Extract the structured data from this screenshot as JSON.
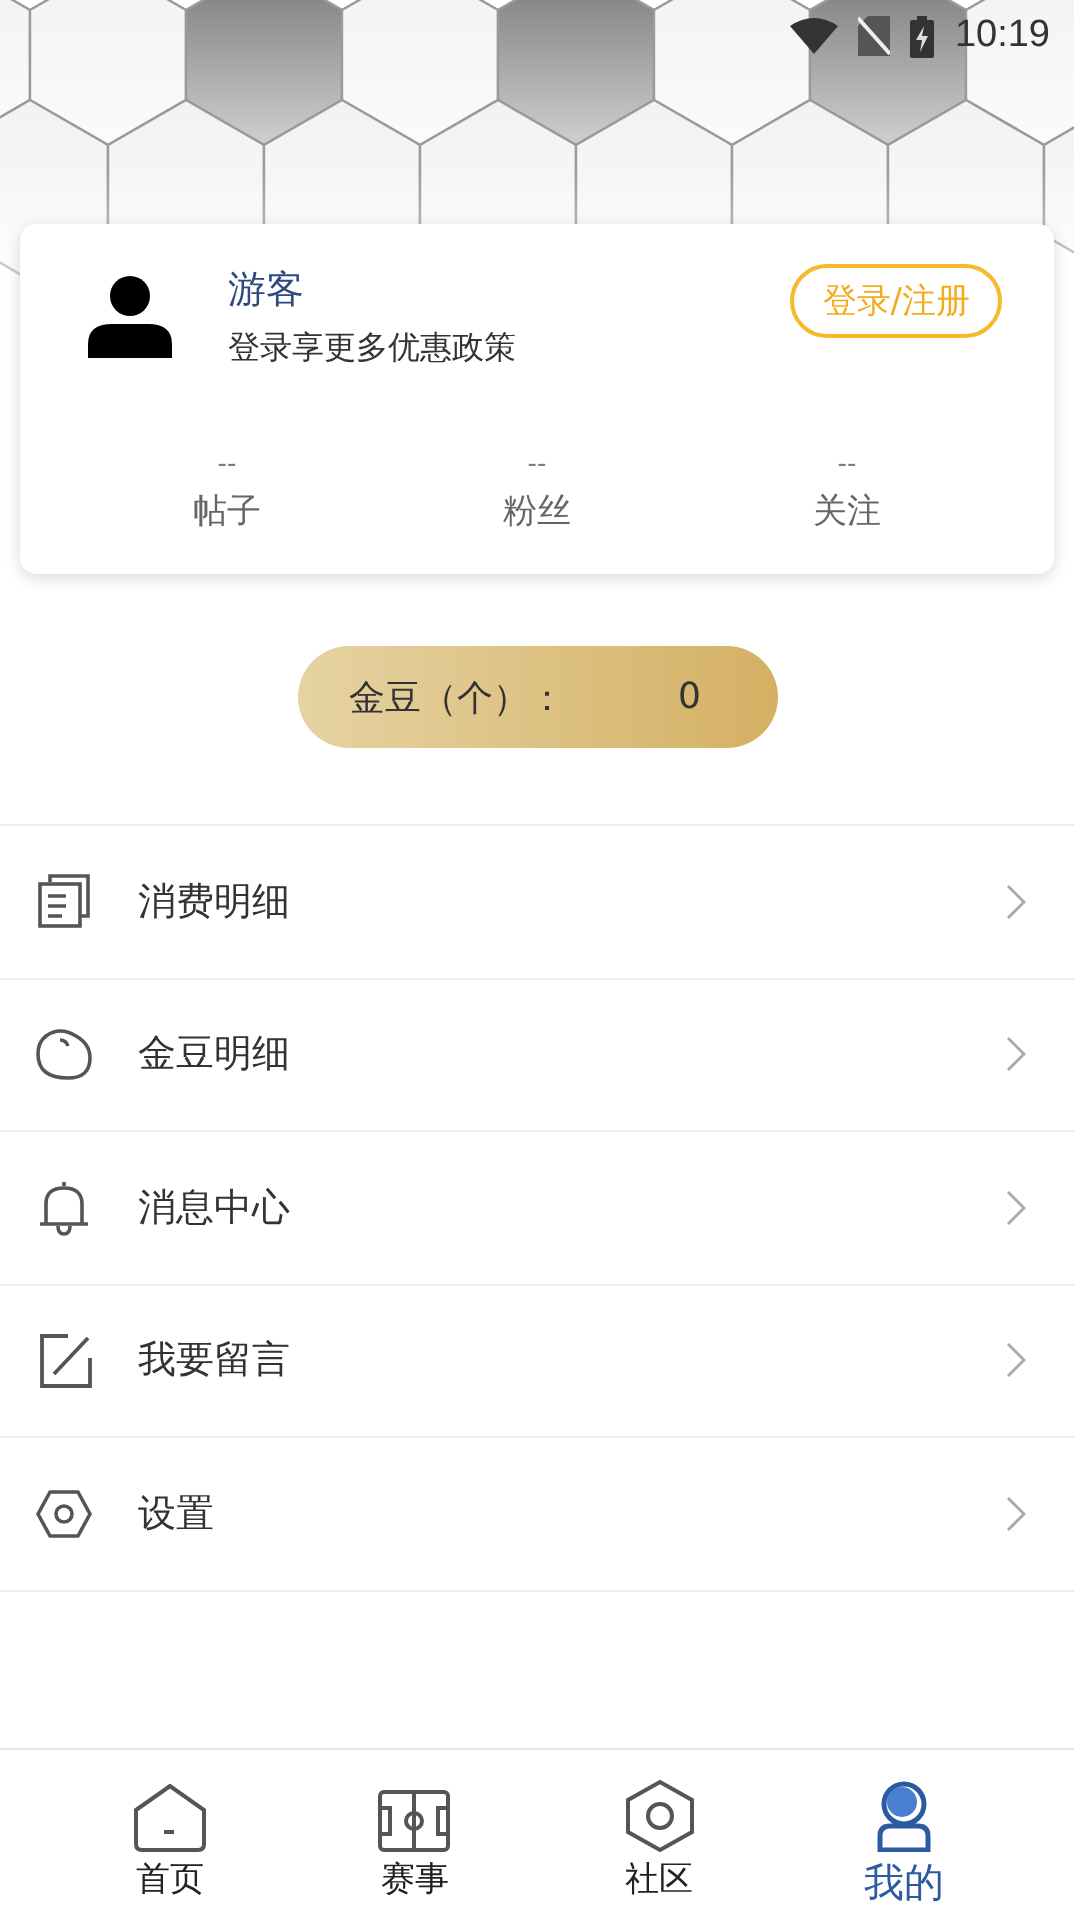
{
  "status_bar": {
    "time": "10:19"
  },
  "profile": {
    "name": "游客",
    "subtitle": "登录享更多优惠政策",
    "login_button": "登录/注册",
    "stats": [
      {
        "value": "--",
        "label": "帖子"
      },
      {
        "value": "--",
        "label": "粉丝"
      },
      {
        "value": "--",
        "label": "关注"
      }
    ]
  },
  "gold_beans": {
    "label": "金豆（个）：",
    "value": "0"
  },
  "menu": [
    {
      "kind": "document",
      "label": "消费明细"
    },
    {
      "kind": "bean",
      "label": "金豆明细"
    },
    {
      "kind": "bell",
      "label": "消息中心"
    },
    {
      "kind": "edit",
      "label": "我要留言"
    },
    {
      "kind": "settings",
      "label": "设置"
    }
  ],
  "tabs": [
    {
      "kind": "home",
      "label": "首页",
      "selected": false
    },
    {
      "kind": "field",
      "label": "赛事",
      "selected": false
    },
    {
      "kind": "hexagon",
      "label": "社区",
      "selected": false
    },
    {
      "kind": "user",
      "label": "我的",
      "selected": true
    }
  ]
}
